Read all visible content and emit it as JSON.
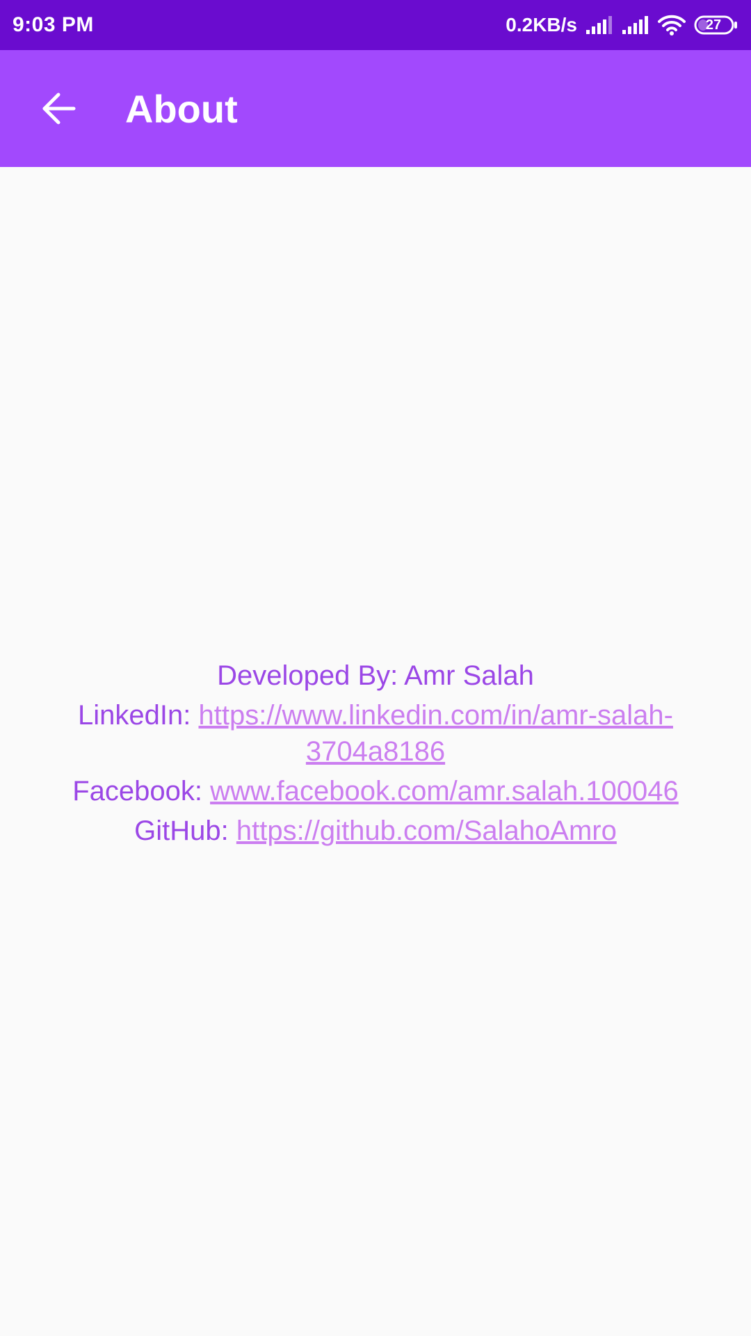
{
  "status_bar": {
    "time": "9:03 PM",
    "net_speed": "0.2KB/s",
    "battery": "27",
    "icons": [
      "signal-icon",
      "signal-icon",
      "wifi-icon",
      "battery-icon"
    ]
  },
  "app_bar": {
    "title": "About",
    "back_icon": "arrow-left-icon",
    "background": "#a249fd"
  },
  "about": {
    "developer_prefix": "Developed By: ",
    "developer_name": "Amr Salah",
    "linkedin_label": "LinkedIn: ",
    "linkedin_url": "https://www.linkedin.com/in/amr-salah-3704a8186",
    "facebook_label": "Facebook: ",
    "facebook_url": "www.facebook.com/amr.salah.100046",
    "github_label": "GitHub: ",
    "github_url": "https://github.com/SalahoAmro"
  },
  "colors": {
    "status_bar": "#6a0ccf",
    "accent": "#a249fd",
    "text": "#9b47e6",
    "link": "#cb7ef0",
    "background": "#fafafa"
  }
}
